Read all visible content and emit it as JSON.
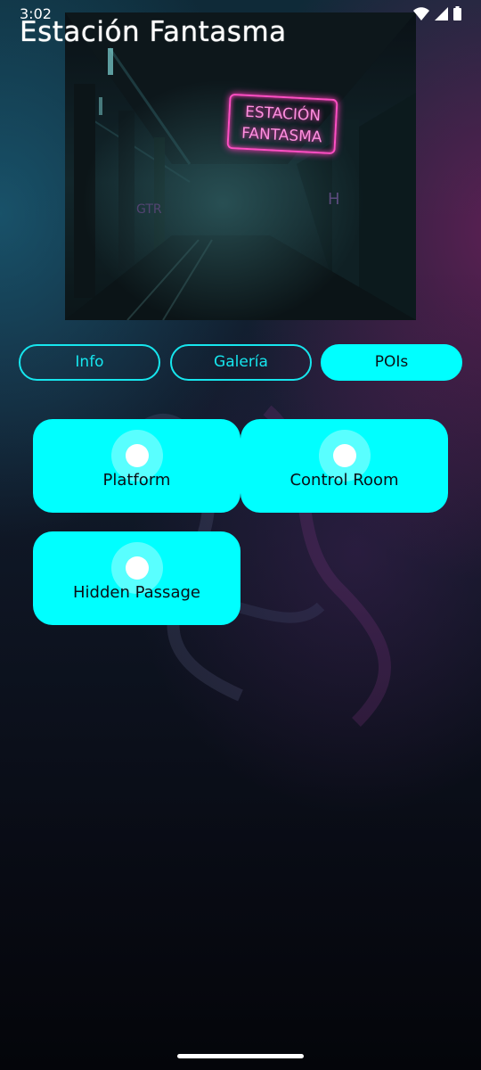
{
  "status_bar": {
    "time": "3:02",
    "icons": [
      "wifi-icon",
      "cell-signal-icon",
      "battery-icon"
    ]
  },
  "app": {
    "title": "Estación Fantasma"
  },
  "hero": {
    "sign_line1": "ESTACIÓN",
    "sign_line2": "FANTASMA"
  },
  "tabs": [
    {
      "label": "Info",
      "active": false
    },
    {
      "label": "Galería",
      "active": false
    },
    {
      "label": "POIs",
      "active": true
    }
  ],
  "pois": [
    {
      "label": "Platform",
      "icon": "location-pin-icon"
    },
    {
      "label": "Control Room",
      "icon": "location-pin-icon"
    },
    {
      "label": "Hidden Passage",
      "icon": "location-pin-icon"
    }
  ],
  "colors": {
    "accent": "#00ffff",
    "neon_pink": "#ff4fc4",
    "text_dark": "#0a0f16"
  }
}
